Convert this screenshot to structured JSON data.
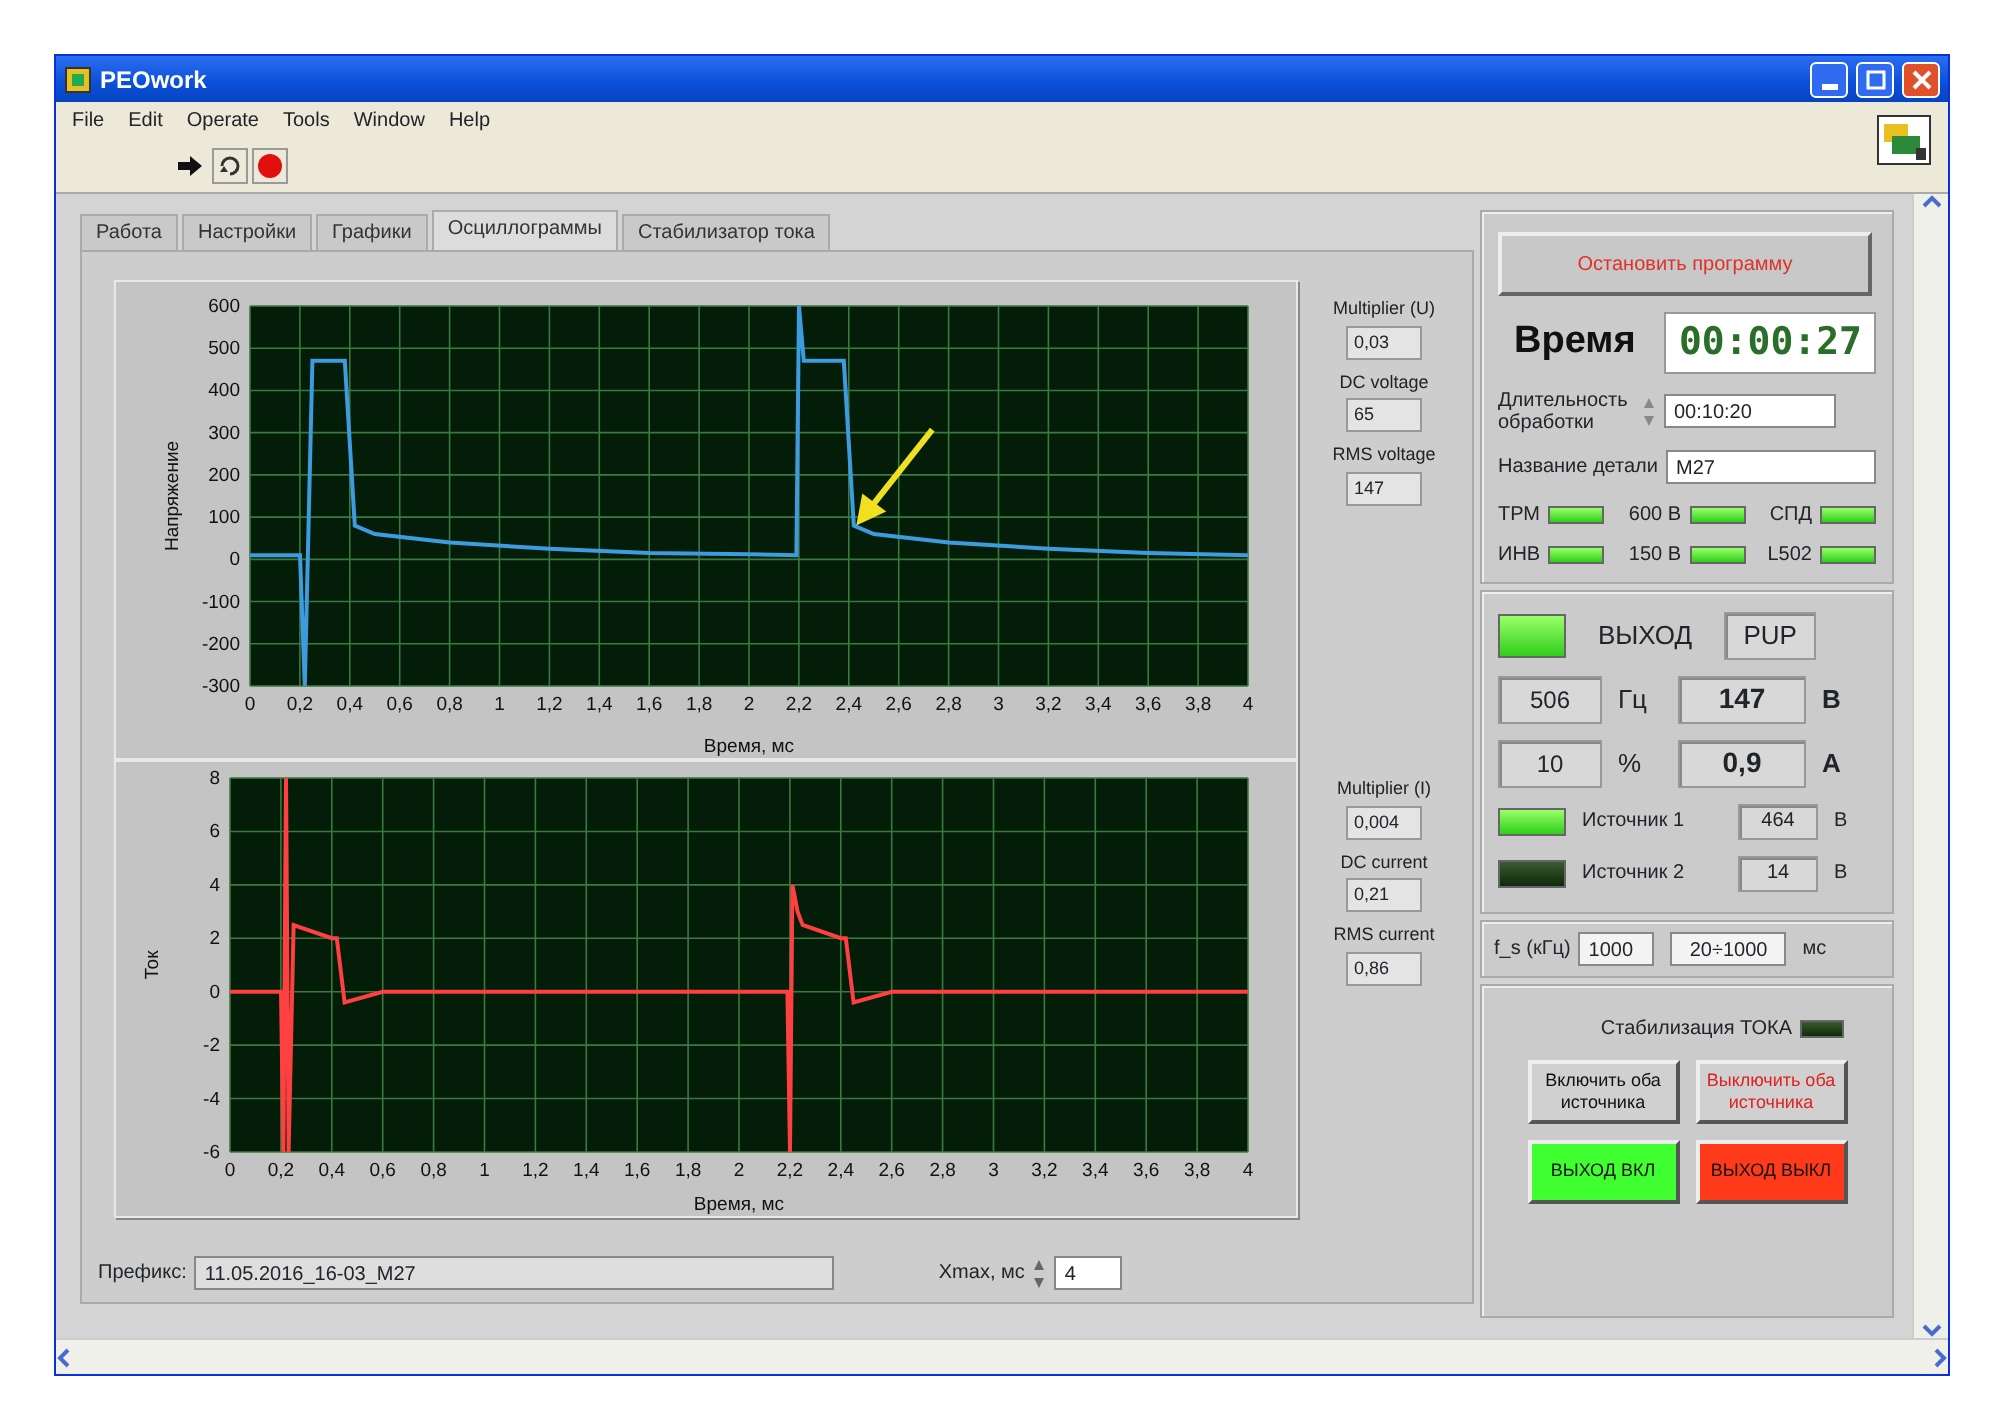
{
  "window": {
    "title": "PEOwork"
  },
  "menu": [
    {
      "label": "File"
    },
    {
      "label": "Edit"
    },
    {
      "label": "Operate"
    },
    {
      "label": "Tools"
    },
    {
      "label": "Window"
    },
    {
      "label": "Help"
    }
  ],
  "tabs": [
    {
      "label": "Работа",
      "selected": false
    },
    {
      "label": "Настройки",
      "selected": false
    },
    {
      "label": "Графики",
      "selected": false
    },
    {
      "label": "Осциллограммы",
      "selected": true
    },
    {
      "label": "Стабилизатор тока",
      "selected": false
    }
  ],
  "charts": [
    {
      "chart_data": {
        "type": "line",
        "xlabel": "Время, мс",
        "ylabel": "Напряжение",
        "xlim": [
          0,
          4
        ],
        "ylim": [
          -300,
          600
        ],
        "xticks": [
          0,
          {
            "value": 0.2,
            "label": "0,2"
          },
          {
            "value": 0.4,
            "label": "0,4"
          },
          {
            "value": 0.6,
            "label": "0,6"
          },
          {
            "value": 0.8,
            "label": "0,8"
          },
          1,
          {
            "value": 1.2,
            "label": "1,2"
          },
          {
            "value": 1.4,
            "label": "1,4"
          },
          {
            "value": 1.6,
            "label": "1,6"
          },
          {
            "value": 1.8,
            "label": "1,8"
          },
          2,
          {
            "value": 2.2,
            "label": "2,2"
          },
          {
            "value": 2.4,
            "label": "2,4"
          },
          {
            "value": 2.6,
            "label": "2,6"
          },
          {
            "value": 2.8,
            "label": "2,8"
          },
          3,
          {
            "value": 3.2,
            "label": "3,2"
          },
          {
            "value": 3.4,
            "label": "3,4"
          },
          {
            "value": 3.6,
            "label": "3,6"
          },
          {
            "value": 3.8,
            "label": "3,8"
          },
          4
        ],
        "yticks": [
          -300,
          -200,
          -100,
          0,
          100,
          200,
          300,
          400,
          500,
          600
        ],
        "x": [
          0,
          0.2,
          0.22,
          0.25,
          0.38,
          0.42,
          0.5,
          0.8,
          1.2,
          1.6,
          2.0,
          2.19,
          2.2,
          2.22,
          2.38,
          2.42,
          2.5,
          2.8,
          3.2,
          3.6,
          4
        ],
        "series": [
          {
            "color": "#3d9be0",
            "values": [
              10,
              10,
              -300,
              470,
              470,
              80,
              60,
              40,
              25,
              15,
              12,
              10,
              600,
              470,
              470,
              80,
              60,
              40,
              25,
              15,
              10
            ]
          }
        ],
        "grid": true
      },
      "pointer_arrow": true,
      "indicators": [
        {
          "label": "Multiplier (U)",
          "value": "0,03"
        },
        {
          "label": "DC voltage",
          "value": "65"
        },
        {
          "label": "RMS voltage",
          "value": "147"
        }
      ]
    },
    {
      "chart_data": {
        "type": "line",
        "xlabel": "Время, мс",
        "ylabel": "Ток",
        "xlim": [
          0,
          4
        ],
        "ylim": [
          -6,
          8
        ],
        "xticks": [
          0,
          {
            "value": 0.2,
            "label": "0,2"
          },
          {
            "value": 0.4,
            "label": "0,4"
          },
          {
            "value": 0.6,
            "label": "0,6"
          },
          {
            "value": 0.8,
            "label": "0,8"
          },
          1,
          {
            "value": 1.2,
            "label": "1,2"
          },
          {
            "value": 1.4,
            "label": "1,4"
          },
          {
            "value": 1.6,
            "label": "1,6"
          },
          {
            "value": 1.8,
            "label": "1,8"
          },
          2,
          {
            "value": 2.2,
            "label": "2,2"
          },
          {
            "value": 2.4,
            "label": "2,4"
          },
          {
            "value": 2.6,
            "label": "2,6"
          },
          {
            "value": 2.8,
            "label": "2,8"
          },
          3,
          {
            "value": 3.2,
            "label": "3,2"
          },
          {
            "value": 3.4,
            "label": "3,4"
          },
          {
            "value": 3.6,
            "label": "3,6"
          },
          {
            "value": 3.8,
            "label": "3,8"
          },
          4
        ],
        "yticks": [
          -6,
          -4,
          -2,
          0,
          2,
          4,
          6,
          8
        ],
        "x": [
          0,
          0.2,
          0.21,
          0.22,
          0.23,
          0.25,
          0.4,
          0.42,
          0.45,
          0.6,
          2.19,
          2.2,
          2.21,
          2.23,
          2.25,
          2.4,
          2.42,
          2.45,
          2.6,
          4
        ],
        "series": [
          {
            "color": "#ff4040",
            "values": [
              0,
              0,
              -6,
              8,
              -6,
              2.5,
              2,
              2,
              -0.4,
              0,
              0,
              -6,
              4,
              3,
              2.5,
              2,
              2,
              -0.4,
              0,
              0
            ]
          }
        ],
        "grid": true
      },
      "indicators": [
        {
          "label": "Multiplier (I)",
          "value": "0,004"
        },
        {
          "label": "DC current",
          "value": "0,21"
        },
        {
          "label": "RMS current",
          "value": "0,86"
        }
      ]
    }
  ],
  "prefix": {
    "label": "Префикс:",
    "value": "11.05.2016_16-03_M27"
  },
  "xmax": {
    "label": "Xmax, мс",
    "value": "4"
  },
  "panel": {
    "stop_button": "Остановить программу",
    "time": {
      "label": "Время",
      "value": "00:00:27"
    },
    "duration": {
      "label": "Длительность обработки",
      "value": "00:10:20"
    },
    "part_name": {
      "label": "Название детали",
      "value": "M27"
    },
    "lamps": [
      {
        "label": "ТРМ",
        "on": true
      },
      {
        "label": "600 В",
        "on": true
      },
      {
        "label": "СПД",
        "on": true
      },
      {
        "label": "ИНВ",
        "on": true
      },
      {
        "label": "150 В",
        "on": true
      },
      {
        "label": "L502",
        "on": true
      }
    ],
    "output": {
      "on": true,
      "label": "ВЫХОД",
      "mode": "PUP"
    },
    "readings": [
      {
        "kind": "setting",
        "value": "506",
        "unit": "Гц"
      },
      {
        "kind": "measured",
        "value": "147",
        "unit": "В"
      },
      {
        "kind": "setting",
        "value": "10",
        "unit": "%"
      },
      {
        "kind": "measured",
        "value": "0,9",
        "unit": "А"
      }
    ],
    "sources": [
      {
        "label": "Источник 1",
        "on": true,
        "value": "464",
        "unit": "В"
      },
      {
        "label": "Источник 2",
        "on": false,
        "value": "14",
        "unit": "В"
      }
    ],
    "fs": {
      "label": "f_s (кГц)",
      "value": "1000",
      "range": "20÷1000",
      "unit": "мс"
    },
    "stabilization": {
      "label": "Стабилизация ТОКА",
      "on": false
    },
    "buttons": [
      {
        "kind": "plain",
        "label": "Включить оба источника"
      },
      {
        "kind": "warn",
        "label": "Выключить оба источника"
      },
      {
        "kind": "on",
        "label": "ВЫХОД ВКЛ"
      },
      {
        "kind": "off",
        "label": "ВЫХОД ВЫКЛ"
      }
    ]
  }
}
